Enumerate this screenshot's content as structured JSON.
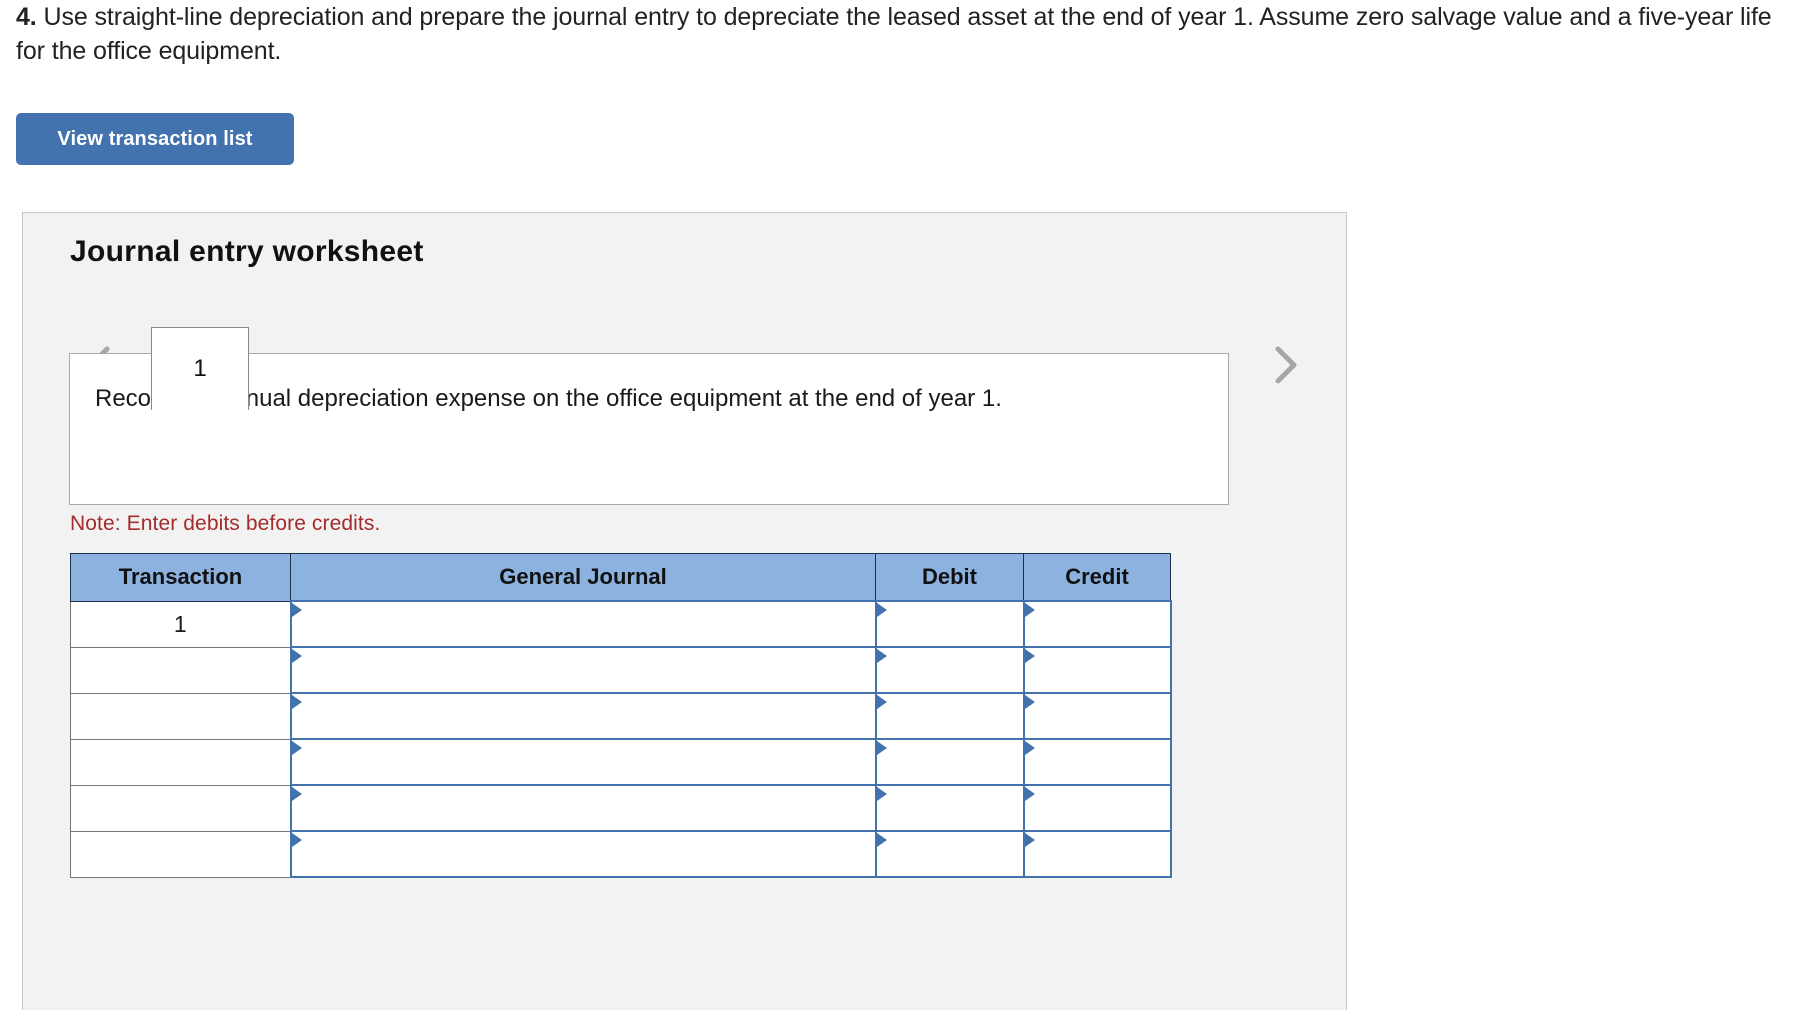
{
  "question": {
    "number": "4.",
    "text": "Use straight-line depreciation and prepare the journal entry to depreciate the leased asset at the end of year 1. Assume zero salvage value and a five-year life for the office equipment."
  },
  "toolbar": {
    "view_transaction_list_label": "View transaction list",
    "button_color": "#4273ae"
  },
  "worksheet": {
    "title": "Journal entry worksheet",
    "prev_icon": "chevron-left-icon",
    "next_icon": "chevron-right-icon",
    "tabs": [
      {
        "label": "1",
        "selected": true
      }
    ],
    "description": "Record the annual depreciation expense on the office equipment at the end of year 1.",
    "note": "Note: Enter debits before credits.",
    "note_color": "#a32c2c"
  },
  "journal_table": {
    "header_color": "#8cb2e0",
    "columns": [
      {
        "key": "transaction",
        "label": "Transaction"
      },
      {
        "key": "general_journal",
        "label": "General Journal"
      },
      {
        "key": "debit",
        "label": "Debit"
      },
      {
        "key": "credit",
        "label": "Credit"
      }
    ],
    "rows": [
      {
        "transaction": "1",
        "general_journal": "",
        "debit": "",
        "credit": ""
      },
      {
        "transaction": "",
        "general_journal": "",
        "debit": "",
        "credit": ""
      },
      {
        "transaction": "",
        "general_journal": "",
        "debit": "",
        "credit": ""
      },
      {
        "transaction": "",
        "general_journal": "",
        "debit": "",
        "credit": ""
      },
      {
        "transaction": "",
        "general_journal": "",
        "debit": "",
        "credit": ""
      },
      {
        "transaction": "",
        "general_journal": "",
        "debit": "",
        "credit": ""
      }
    ]
  }
}
